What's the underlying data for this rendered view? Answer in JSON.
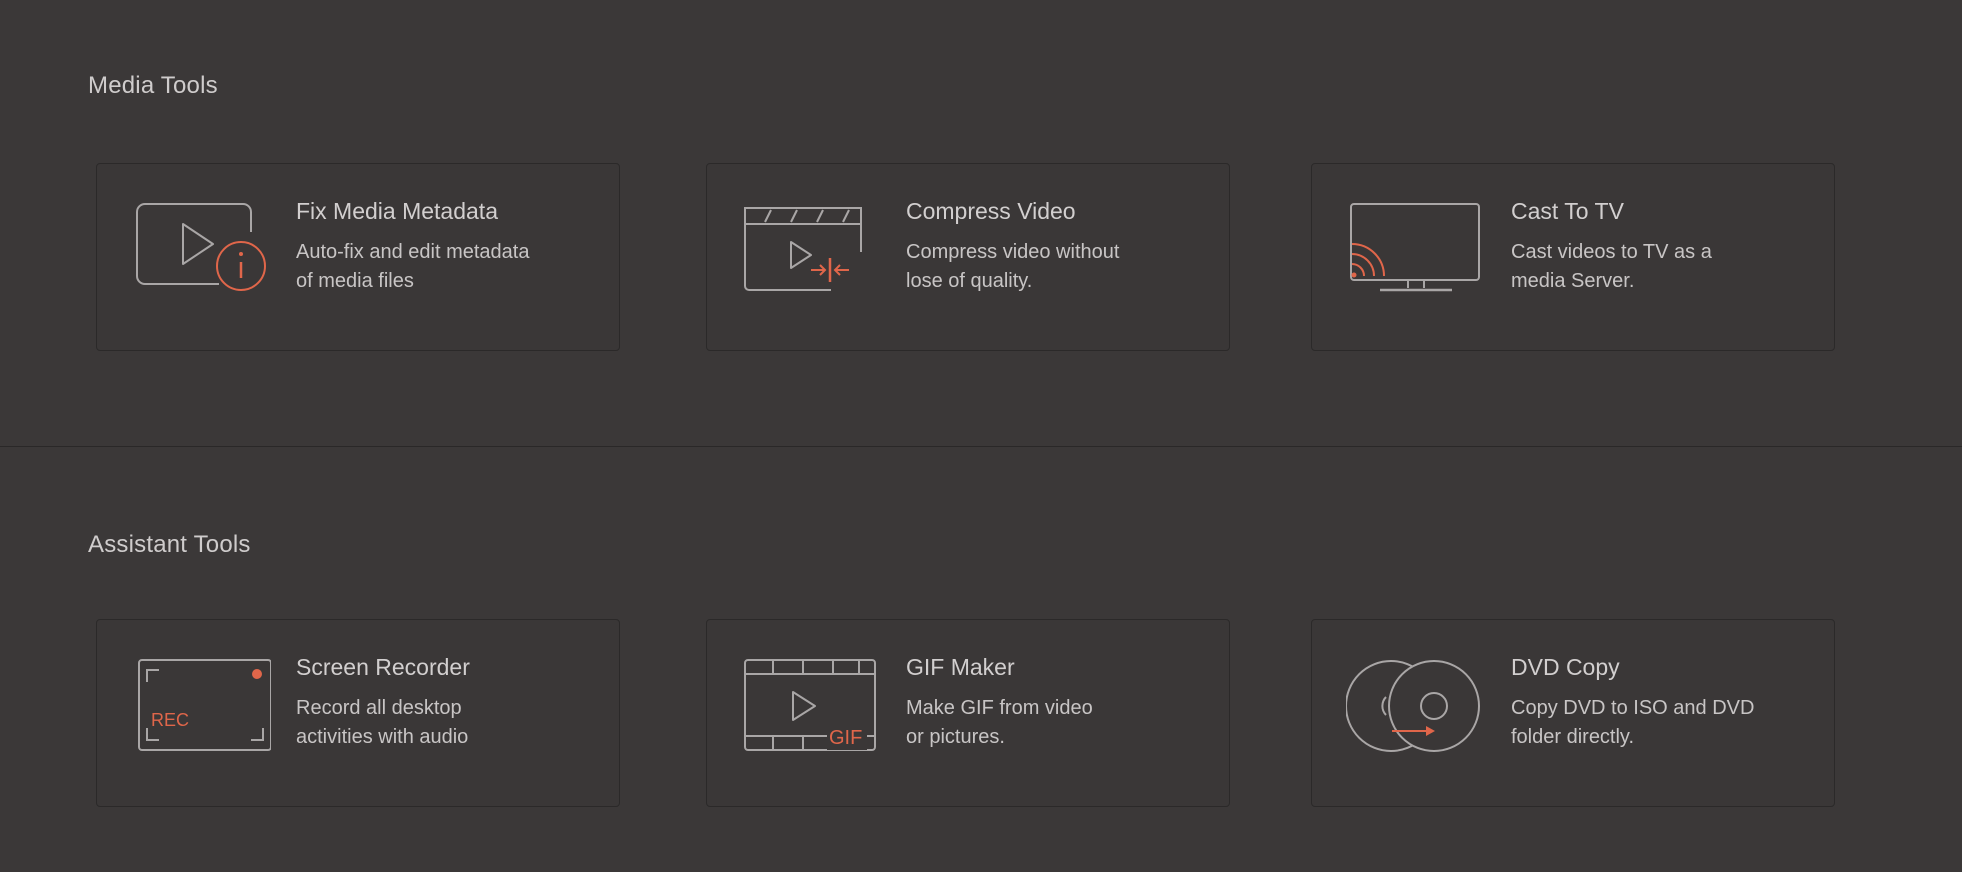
{
  "colors": {
    "background": "#3b3838",
    "card_background": "#3a3737",
    "icon_stroke": "#a9a6a6",
    "accent": "#e0664a"
  },
  "media_tools": {
    "title": "Media Tools",
    "cards": [
      {
        "icon": "video-info-icon",
        "title": "Fix Media Metadata",
        "desc_line1": "Auto-fix and edit metadata",
        "desc_line2": "of media files"
      },
      {
        "icon": "compress-video-icon",
        "title": "Compress Video",
        "desc_line1": "Compress video without",
        "desc_line2": "lose of quality."
      },
      {
        "icon": "cast-tv-icon",
        "title": "Cast To TV",
        "desc_line1": "Cast videos to TV as a",
        "desc_line2": "media Server."
      }
    ]
  },
  "assistant_tools": {
    "title": "Assistant Tools",
    "cards": [
      {
        "icon": "screen-recorder-icon",
        "icon_text": "REC",
        "title": "Screen Recorder",
        "desc_line1": "Record all desktop",
        "desc_line2": "activities with audio"
      },
      {
        "icon": "gif-maker-icon",
        "icon_text": "GIF",
        "title": "GIF Maker",
        "desc_line1": "Make GIF from video",
        "desc_line2": "or pictures."
      },
      {
        "icon": "dvd-copy-icon",
        "title": "DVD Copy",
        "desc_line1": "Copy DVD to ISO and DVD",
        "desc_line2": "folder directly."
      }
    ]
  }
}
